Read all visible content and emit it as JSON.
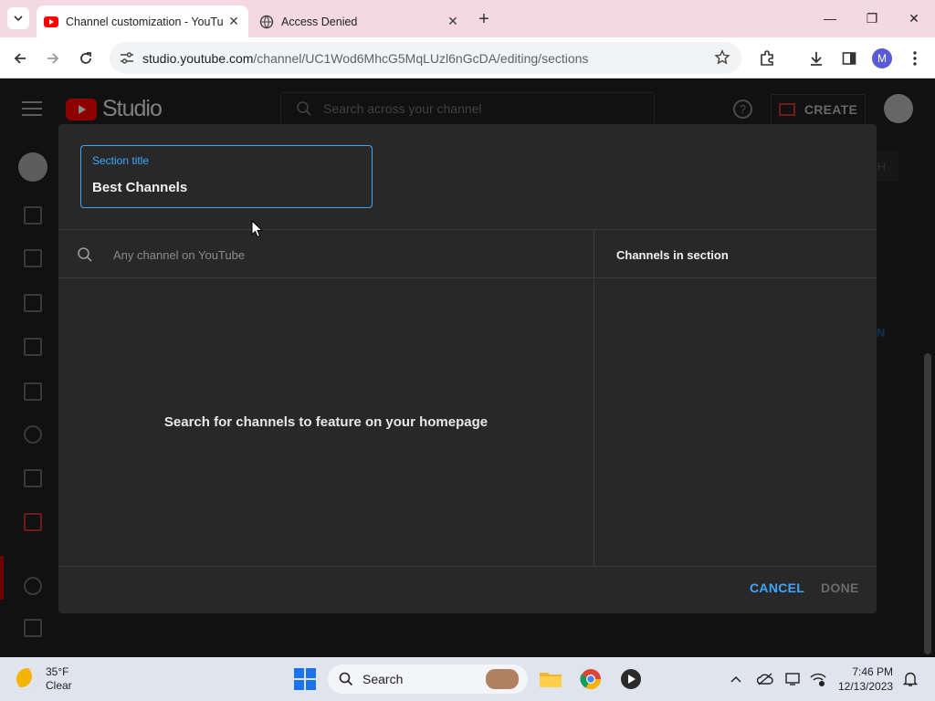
{
  "browser": {
    "tabs": [
      {
        "title": "Channel customization - YouTube",
        "active": true
      },
      {
        "title": "Access Denied",
        "active": false
      }
    ],
    "url_host": "studio.youtube.com",
    "url_path": "/channel/UC1Wod6MhcG5MqLUzl6nGcDA/editing/sections",
    "profile_initial": "M"
  },
  "studio": {
    "logo_text": "Studio",
    "search_placeholder": "Search across your channel",
    "create_label": "CREATE",
    "help_glyph": "?"
  },
  "dialog": {
    "section_title_label": "Section title",
    "section_title_value": "Best Channels",
    "channel_search_placeholder": "Any channel on YouTube",
    "channels_heading": "Channels in section",
    "empty_message": "Search for channels to feature on your homepage",
    "cancel_label": "CANCEL",
    "done_label": "DONE"
  },
  "taskbar": {
    "weather_temp": "35°F",
    "weather_desc": "Clear",
    "search_label": "Search",
    "time": "7:46 PM",
    "date": "12/13/2023"
  },
  "colors": {
    "accent_blue": "#3ea6ff",
    "dialog_bg": "#282828",
    "youtube_red": "#ff0000"
  }
}
